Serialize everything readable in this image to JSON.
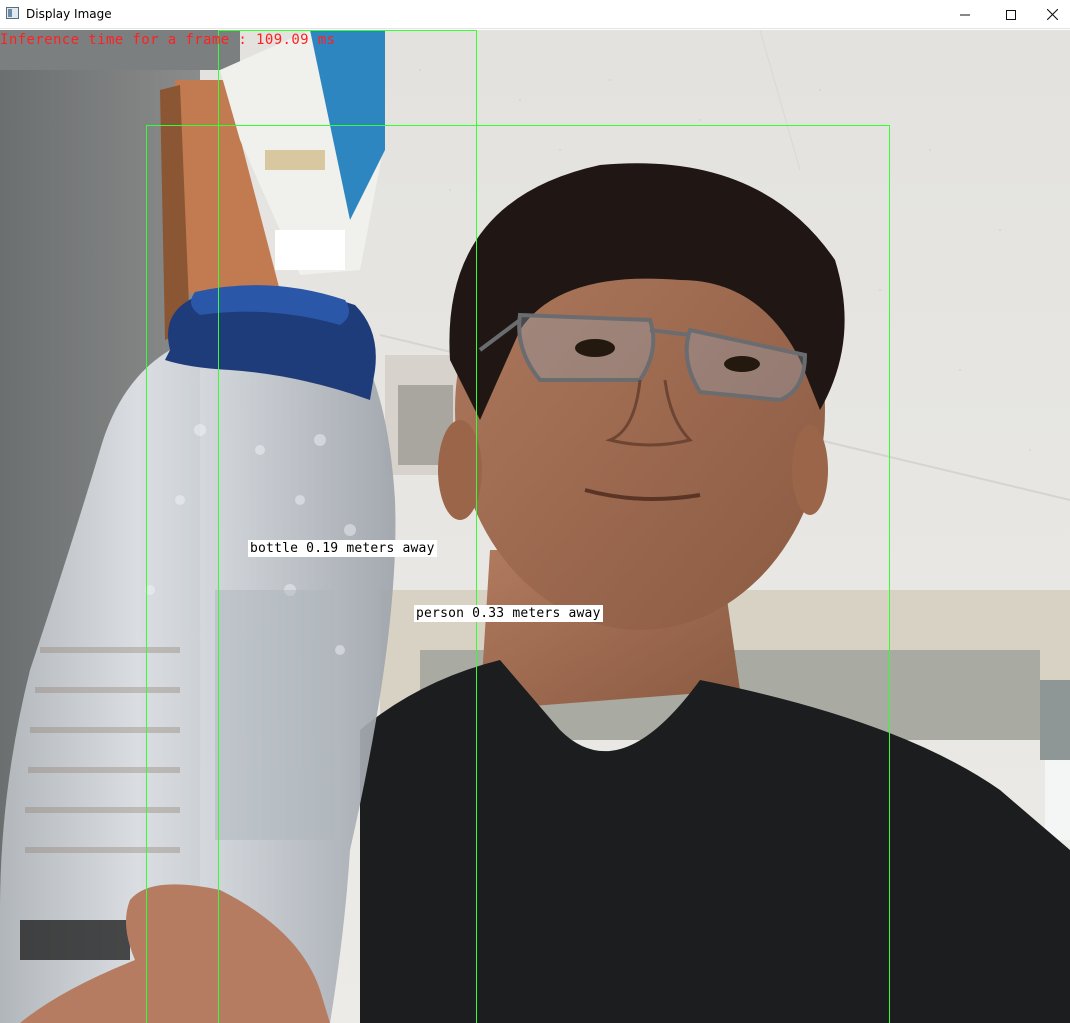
{
  "window": {
    "title": "Display Image",
    "icon": "app-window-icon",
    "controls": {
      "minimize_icon": "minimize-icon",
      "maximize_icon": "maximize-icon",
      "close_icon": "close-icon"
    }
  },
  "overlay": {
    "inference_text": "Inference time for a frame : 109.09 ms",
    "inference_color": "#ff2020",
    "box_color": "#33ff33"
  },
  "detections": [
    {
      "label": "bottle 0.19 meters away"
    },
    {
      "label": "person 0.33 meters away"
    }
  ]
}
